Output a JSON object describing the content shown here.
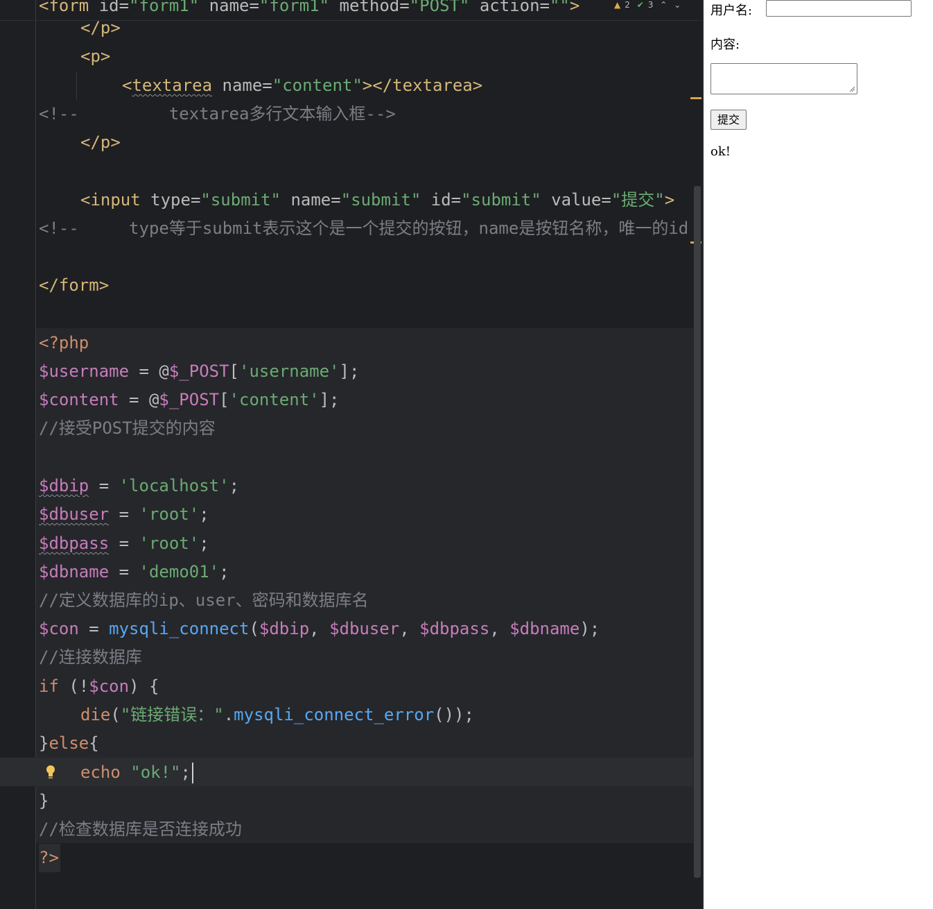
{
  "editor": {
    "inspection": {
      "warnings": "2",
      "weak_warnings": "3"
    },
    "html_lines": [
      {
        "tag_open": "<form ",
        "a1": "id=",
        "v1": "\"form1\"",
        "a2": " name=",
        "v2": "\"form1\"",
        "a3": " method=",
        "v3": "\"POST\"",
        "a4": " action=",
        "v4": "\"\"",
        "tag_close": ">"
      },
      {
        "text": "</p>"
      },
      {
        "text": "<p>"
      },
      {
        "tag_open": "<",
        "tag_name": "textarea",
        "a1": " name=",
        "v1": "\"content\"",
        "tag_close": "></textarea>"
      },
      {
        "comment": "<!--         textarea多行文本输入框-->"
      },
      {
        "text": "</p>"
      },
      {
        "tag_open": "<input ",
        "a1": "type=",
        "v1": "\"submit\"",
        "a2": " name=",
        "v2": "\"submit\"",
        "a3": " id=",
        "v3": "\"submit\"",
        "a4": " value=",
        "v4": "\"提交\"",
        "tag_close": ">"
      },
      {
        "comment": "<!--     type等于submit表示这个是一个提交的按钮，name是按钮名称，唯一的id"
      },
      {
        "text": "</form>"
      }
    ],
    "php_lines": {
      "open": "<?php",
      "l1_var": "$username",
      "l1_op": " = @",
      "l1_post": "$_POST",
      "l1_b1": "[",
      "l1_str": "'username'",
      "l1_end": "];",
      "l2_var": "$content",
      "l2_op": " = @",
      "l2_post": "$_POST",
      "l2_b1": "[",
      "l2_str": "'content'",
      "l2_end": "];",
      "c1": "//接受POST提交的内容",
      "l3_var": "$dbip",
      "l3_op": " = ",
      "l3_str": "'localhost'",
      "l3_end": ";",
      "l4_var": "$dbuser",
      "l4_op": " = ",
      "l4_str": "'root'",
      "l4_end": ";",
      "l5_var": "$dbpass",
      "l5_op": " = ",
      "l5_str": "'root'",
      "l5_end": ";",
      "l6_var": "$dbname",
      "l6_op": " = ",
      "l6_str": "'demo01'",
      "l6_end": ";",
      "c2": "//定义数据库的ip、user、密码和数据库名",
      "l7_var": "$con",
      "l7_op": " = ",
      "l7_fn": "mysqli_connect",
      "l7_p1": "(",
      "l7_a1": "$dbip",
      "l7_s1": ", ",
      "l7_a2": "$dbuser",
      "l7_s2": ", ",
      "l7_a3": "$dbpass",
      "l7_s3": ", ",
      "l7_a4": "$dbname",
      "l7_end": ");",
      "c3": "//连接数据库",
      "l8_kw": "if",
      "l8_p1": " (!",
      "l8_var": "$con",
      "l8_end": ") {",
      "l9_kw": "die",
      "l9_p1": "(",
      "l9_str": "\"链接错误：\"",
      "l9_dot": ".",
      "l9_fn": "mysqli_connect_error",
      "l9_end": "());",
      "l10_b": "}",
      "l10_kw": "else",
      "l10_b2": "{",
      "l11_kw": "echo",
      "l11_sp": " ",
      "l11_str": "\"ok!\"",
      "l11_end": ";",
      "l12": "}",
      "c4": "//检查数据库是否连接成功",
      "close": "?>"
    }
  },
  "preview": {
    "username_label": "用户名:",
    "username_value": "",
    "content_label": "内容:",
    "content_value": "",
    "submit_label": "提交",
    "output": "ok!"
  }
}
